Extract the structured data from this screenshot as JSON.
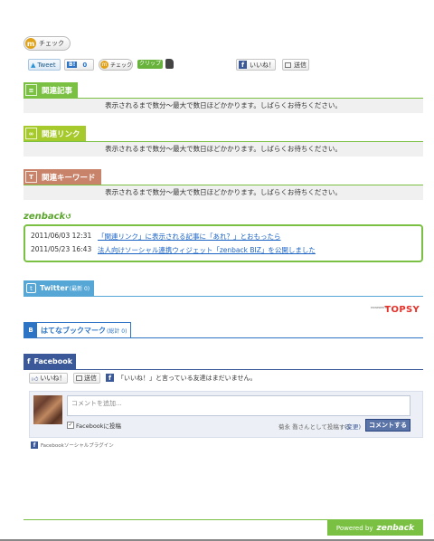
{
  "top_check": {
    "label": "チェック"
  },
  "share_bar": {
    "tweet_label": "Tweet",
    "hatena_count": "0",
    "mixi_check_label": "チェック",
    "clip_label": "クリップ",
    "fb_like_label": "いいね！",
    "fb_send_label": "送信"
  },
  "sections": {
    "related_articles": {
      "title": "関連記事",
      "notice": "表示されるまで数分～最大で数日ほどかかります。しばらくお待ちください。"
    },
    "related_links": {
      "title": "関連リンク",
      "notice": "表示されるまで数分～最大で数日ほどかかります。しばらくお待ちください。"
    },
    "related_keywords": {
      "title": "関連キーワード",
      "notice": "表示されるまで数分～最大で数日ほどかかります。しばらくお待ちください。"
    }
  },
  "zenback": {
    "logo": "zenback",
    "news": [
      {
        "date": "2011/06/03 12:31",
        "title": "「関連リンク」に表示される記事に「あれ？」とおもったら"
      },
      {
        "date": "2011/05/23 16:43",
        "title": "法人向けソーシャル連携ウィジェット「zenback BIZ」を公開しました"
      }
    ]
  },
  "twitter": {
    "title": "Twitter",
    "suffix": "(最新 0)"
  },
  "topsy": {
    "powered": "POWERED BY",
    "brand": "TOPSY"
  },
  "hatena_bookmark": {
    "icon": "B",
    "title": "はてなブックマーク",
    "suffix": "(総計 0)"
  },
  "facebook": {
    "title": "Facebook",
    "like_label": "いいね！",
    "send_label": "送信",
    "like_message": "「いいね！」と言っている友達はまだいません。",
    "comment_placeholder": "コメントを追加...",
    "post_to_fb_label": "Facebookに投稿",
    "posting_as": "菊永 喬さんとして投稿する",
    "change_label": "(変更)",
    "comment_button": "コメントする",
    "plugin_label": "Facebookソーシャルプラグイン"
  },
  "footer": {
    "powered_by": "Powered by",
    "brand": "zenback"
  },
  "colors": {
    "accent_green": "#7ac143",
    "articles_tab": "#7ac143",
    "links_tab": "#a6c92c",
    "keywords_tab": "#c8836a",
    "twitter_blue": "#57a7d6",
    "hatena_blue": "#2d75c4",
    "facebook_blue": "#3b5998",
    "topsy_red": "#e4322b"
  }
}
